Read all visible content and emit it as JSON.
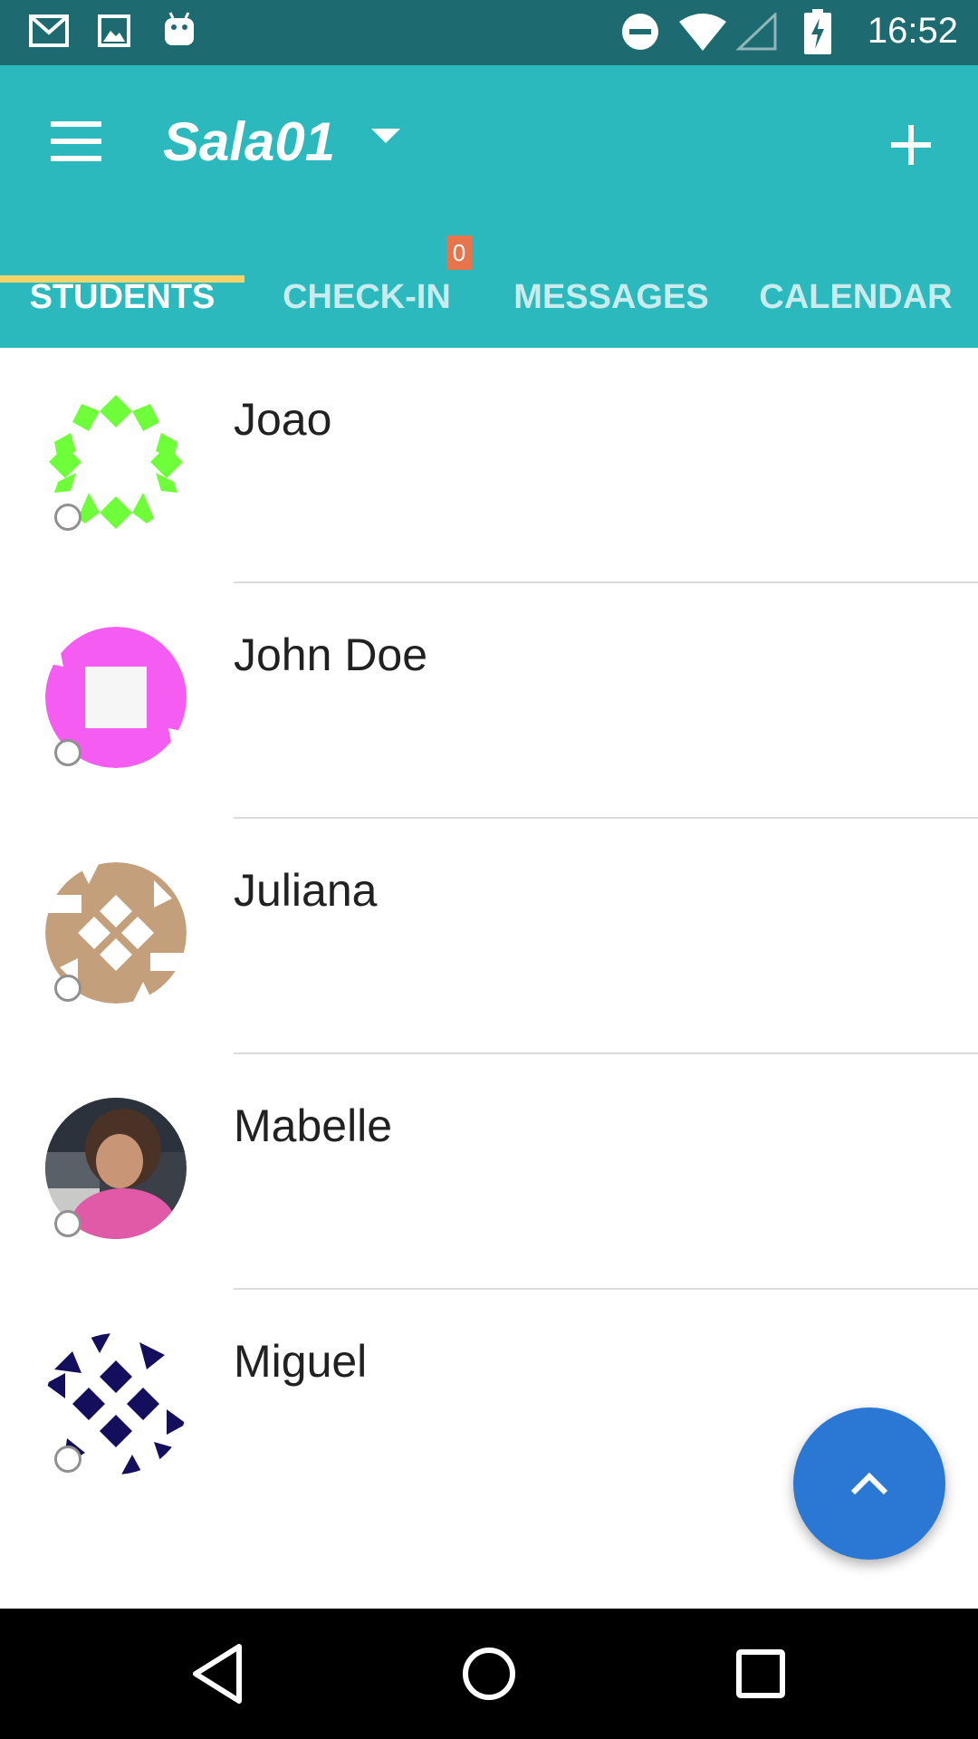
{
  "status_bar": {
    "time": "16:52",
    "icons": [
      "gmail-icon",
      "gallery-icon",
      "android-icon",
      "do-not-disturb-icon",
      "wifi-icon",
      "signal-icon",
      "battery-charging-icon"
    ]
  },
  "app_bar": {
    "menu_icon": "menu-icon",
    "title": "Sala01",
    "dropdown_icon": "dropdown-arrow-icon",
    "add_icon": "plus-icon"
  },
  "tabs": [
    {
      "label": "STUDENTS",
      "active": true
    },
    {
      "label": "CHECK-IN",
      "active": false,
      "badge": "0"
    },
    {
      "label": "MESSAGES",
      "active": false
    },
    {
      "label": "CALENDAR",
      "active": false
    }
  ],
  "students": [
    {
      "name": "Joao",
      "avatar_color": "#6fff3a"
    },
    {
      "name": "John Doe",
      "avatar_color": "#f55df2"
    },
    {
      "name": "Juliana",
      "avatar_color": "#c49f7c"
    },
    {
      "name": "Mabelle",
      "avatar_color": "#e05aa8"
    },
    {
      "name": "Miguel",
      "avatar_color": "#140f5c"
    }
  ],
  "fab": {
    "icon": "chevron-up-icon",
    "color": "#2b78d4"
  },
  "nav_bar": {
    "icons": [
      "back-icon",
      "home-icon",
      "recents-icon"
    ]
  },
  "colors": {
    "primary": "#2cb9bd",
    "status_bar": "#1d6b70",
    "indicator": "#f3d46a",
    "badge": "#e8744b"
  }
}
